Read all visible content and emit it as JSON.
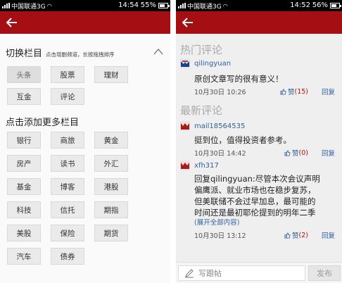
{
  "left": {
    "status": {
      "carrier": "中国联通3G",
      "time": "14:54",
      "battery": "55%",
      "battery_level": 0.55
    },
    "section1": {
      "title": "切换栏目",
      "hint": "点击增删频道，长按拖拽排序"
    },
    "subscribed": [
      "头条",
      "股票",
      "理财",
      "互金",
      "评论"
    ],
    "section2": {
      "title": "点击添加更多栏目"
    },
    "more": [
      "银行",
      "商旅",
      "黄金",
      "房产",
      "读书",
      "外汇",
      "基金",
      "博客",
      "港股",
      "科技",
      "信托",
      "期指",
      "美股",
      "保险",
      "期货",
      "汽车",
      "债券"
    ]
  },
  "right": {
    "status": {
      "carrier": "中国联通3G",
      "time": "14:52",
      "battery": "56%",
      "battery_level": 0.56
    },
    "hot_title": "热门评论",
    "new_title": "最新评论",
    "comments": [
      {
        "user": "qilingyuan",
        "text": "原创文章写的很有意义！",
        "time": "10月30日 10:26",
        "like_label": "赞",
        "likes": "(15)",
        "reply": "回复"
      },
      {
        "user": "mail18564535",
        "text": "挺到位，值得投资者参考。",
        "time": "10月30日 14:42",
        "like_label": "赞",
        "likes": "(0)",
        "reply": "回复"
      },
      {
        "user": "xfh317",
        "lines": [
          "回复qilingyuan:尽管本次会议声明",
          "偏鹰派、就业市场也在稳步复苏，",
          "但美联储不会过早加息，最可能的",
          "时间还是最初耶伦提到的明年二季"
        ],
        "expand": "(展开全部内容)",
        "time": "10月30日 13:12",
        "like_label": "赞",
        "likes": "(2)",
        "reply": "回复"
      }
    ],
    "input_placeholder": "写跟帖",
    "send": "发布"
  }
}
